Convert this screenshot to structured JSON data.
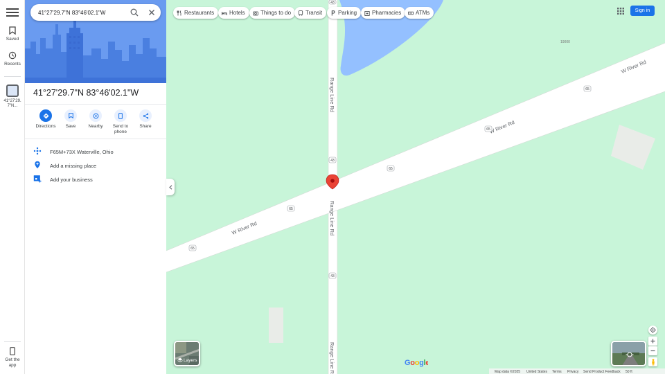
{
  "search": {
    "value": "41°27'29.7\"N 83°46'02.1\"W"
  },
  "rail": {
    "saved": "Saved",
    "recents": "Recents",
    "current": "41°27'29.7\"N...",
    "get_app": "Get the app"
  },
  "place": {
    "title": "41°27'29.7\"N 83°46'02.1\"W",
    "actions": [
      {
        "label": "Directions",
        "icon": "directions-icon"
      },
      {
        "label": "Save",
        "icon": "bookmark-icon"
      },
      {
        "label": "Nearby",
        "icon": "nearby-icon"
      },
      {
        "label": "Send to phone",
        "icon": "phone-icon"
      },
      {
        "label": "Share",
        "icon": "share-icon"
      }
    ],
    "plus_code": "F65M+73X Waterville, Ohio",
    "add_place": "Add a missing place",
    "add_business": "Add your business"
  },
  "chips": [
    {
      "label": "Restaurants",
      "icon": "fork-knife-icon"
    },
    {
      "label": "Hotels",
      "icon": "bed-icon"
    },
    {
      "label": "Things to do",
      "icon": "camera-icon"
    },
    {
      "label": "Transit",
      "icon": "train-icon"
    },
    {
      "label": "Parking",
      "icon": "parking-icon"
    },
    {
      "label": "Pharmacies",
      "icon": "pharmacy-icon"
    },
    {
      "label": "ATMs",
      "icon": "atm-icon"
    }
  ],
  "header": {
    "signin": "Sign in"
  },
  "map": {
    "road_w_river": "W River Rd",
    "road_range_line": "Range Line Rd",
    "route_65": "65",
    "route_43": "43",
    "label_19000": "19000",
    "layers_label": "Layers",
    "google_logo": "Google"
  },
  "footer": {
    "map_data": "Map data ©2025",
    "country": "United States",
    "terms": "Terms",
    "privacy": "Privacy",
    "feedback": "Send Product Feedback",
    "scale": "50 ft"
  },
  "colors": {
    "map_bg": "#c8f5d9",
    "road": "#ffffff",
    "water": "#94c0ff",
    "accent": "#1a73e8",
    "pin": "#ea4335"
  }
}
